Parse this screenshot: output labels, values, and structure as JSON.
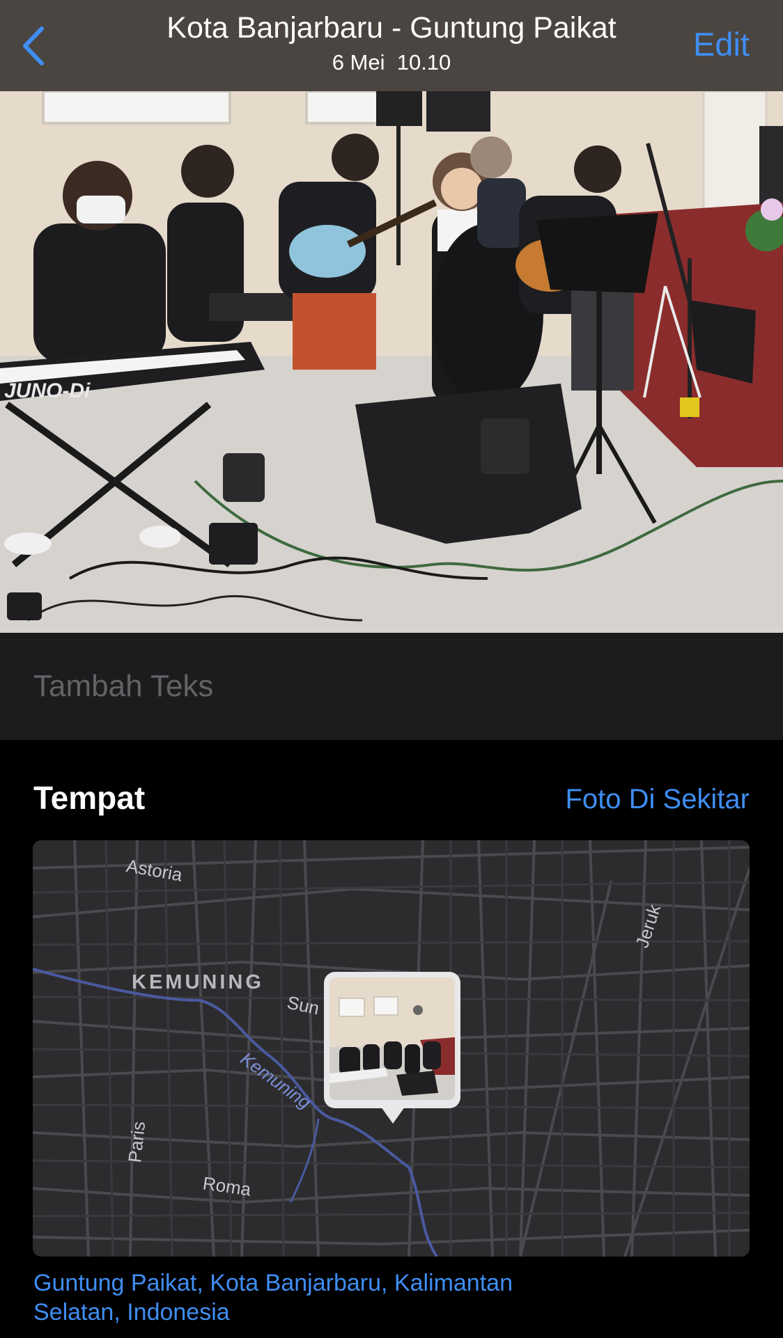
{
  "nav": {
    "title": "Kota Banjarbaru - Guntung Paikat",
    "subtitle": "6 Mei  10.10",
    "edit_label": "Edit",
    "back_icon": "chevron-left-icon"
  },
  "caption": {
    "placeholder": "Tambah Teks",
    "value": ""
  },
  "place": {
    "title": "Tempat",
    "nearby_link": "Foto Di Sekitar",
    "map_labels": {
      "astoria": "Astoria",
      "kemuning_district": "KEMUNING",
      "sun": "Sun",
      "jeruk": "Jeruk",
      "kemuning_river": "Kemuning",
      "paris": "Paris",
      "roma": "Roma"
    },
    "address": "Guntung Paikat, Kota Banjarbaru, Kalimantan Selatan, Indonesia"
  },
  "photo_overlay": {
    "keyboard_brand": "JUNO-Di"
  },
  "colors": {
    "accent": "#3f8ef2",
    "navbar_bg": "#4a4540",
    "caption_bg": "#1c1c1e",
    "map_bg": "#2c2c2e"
  }
}
